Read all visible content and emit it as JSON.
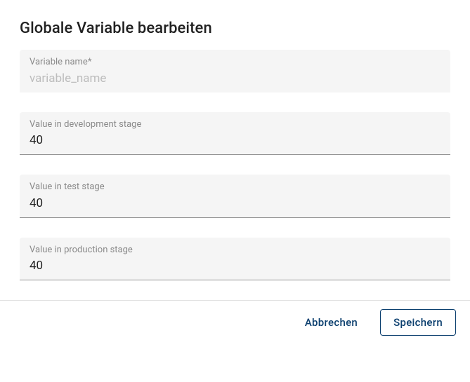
{
  "title": "Globale Variable bearbeiten",
  "fields": {
    "name": {
      "label": "Variable name*",
      "placeholder": "variable_name",
      "value": ""
    },
    "dev": {
      "label": "Value in development stage",
      "value": "40"
    },
    "test": {
      "label": "Value in test stage",
      "value": "40"
    },
    "prod": {
      "label": "Value in production stage",
      "value": "40"
    }
  },
  "actions": {
    "cancel": "Abbrechen",
    "save": "Speichern"
  }
}
